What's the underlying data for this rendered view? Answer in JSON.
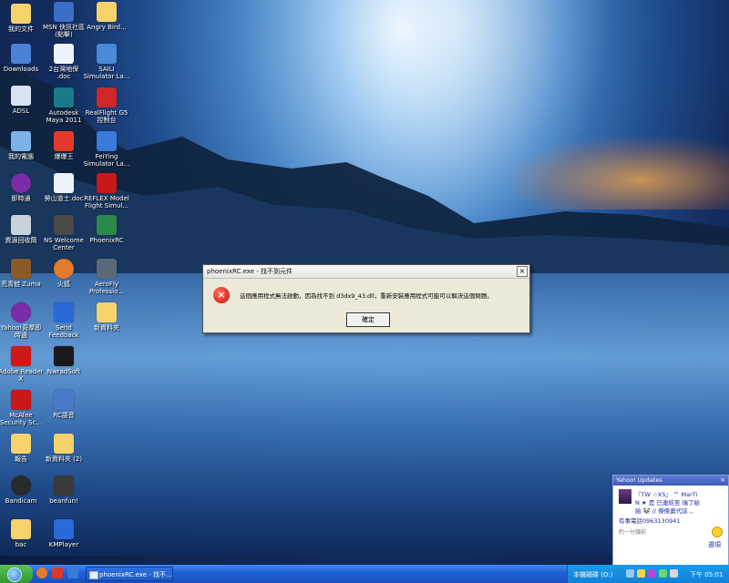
{
  "desktop_icons": [
    {
      "label": "我的文件",
      "color": "#f5d36a"
    },
    {
      "label": "Downloads",
      "color": "#4a82d8"
    },
    {
      "label": "ADSL",
      "color": "#d9e4f2"
    },
    {
      "label": "我的電腦",
      "color": "#7cb2e8"
    },
    {
      "label": "即時通",
      "color": "#7a2ca8"
    },
    {
      "label": "資源回收筒",
      "color": "#c7d3dc"
    },
    {
      "label": "荒青蛙 Zuma",
      "color": "#8a5a28"
    },
    {
      "label": "Yahoo!奇摩即\n時通",
      "color": "#7a2ca8"
    },
    {
      "label": "Adobe Reader\nX",
      "color": "#d01818"
    },
    {
      "label": "McAfee\nSecurity Sc...",
      "color": "#c81818"
    },
    {
      "label": "報告",
      "color": "#f5d36a"
    },
    {
      "label": "Bandicam",
      "color": "#2a2a2a"
    },
    {
      "label": "bac",
      "color": "#f5d36a"
    },
    {
      "label": "MSN 快訊社區\n(點擊)",
      "color": "#3a6ec8"
    },
    {
      "label": "2台灣地保\n.doc",
      "color": "#eef3fb"
    },
    {
      "label": "Autodesk\nMaya 2011",
      "color": "#1a7a8a"
    },
    {
      "label": "爆爆王",
      "color": "#e23b2b"
    },
    {
      "label": "勞山道士.doc",
      "color": "#eef3fb"
    },
    {
      "label": "NS Welcome\nCenter",
      "color": "#4a4a4a"
    },
    {
      "label": "火狐",
      "color": "#e27b2b"
    },
    {
      "label": "Send\nFeedback",
      "color": "#2a6ad8"
    },
    {
      "label": "NwradSoft",
      "color": "#1a1a1a"
    },
    {
      "label": "RC語音",
      "color": "#4a7ac8"
    },
    {
      "label": "新資料夾 (2)",
      "color": "#f5d36a"
    },
    {
      "label": "beanfun!",
      "color": "#3a3a3a"
    },
    {
      "label": "KMPlayer",
      "color": "#2a6ad8"
    },
    {
      "label": "Angry Bird...",
      "color": "#f5d36a"
    },
    {
      "label": "SAILI\nSimulator La...",
      "color": "#4a8ad8"
    },
    {
      "label": "RealFlight G5\n控制台",
      "color": "#d02828"
    },
    {
      "label": "FeiYing\nSimulator La...",
      "color": "#3a7ad8"
    },
    {
      "label": "REFLEX Model\nFlight Simul...",
      "color": "#c81818"
    },
    {
      "label": "PhoenixRC",
      "color": "#2a8a4a"
    },
    {
      "label": "AeroFly\nProfessio...",
      "color": "#5a6a7a"
    },
    {
      "label": "新資料夾",
      "color": "#f5d36a"
    }
  ],
  "dialog": {
    "title": "phoenixRC.exe - 找不到元件",
    "close": "×",
    "error_glyph": "×",
    "message": "這個應用程式無法啟動，因為找不到 d3dx9_43.dll，重新安裝應用程式可能可以解決這個問題。",
    "ok": "確定"
  },
  "taskbar": {
    "task_button": "phoenixRC.exe - 找不...",
    "tray_language": "本機磁碟 (D:)",
    "clock": "下午 05:01"
  },
  "notice": {
    "title": "Yahoo! Updates",
    "close": "×",
    "line1": "『TW ☆XS』 ™  MarTi",
    "line2": "N ★ 是  已連結至 瑞了給",
    "line3": "給 🐼 // 傑傑奧代誌 ,,",
    "line4": "有事電話0963130941",
    "time": "約一分鐘前",
    "link": "選項"
  }
}
